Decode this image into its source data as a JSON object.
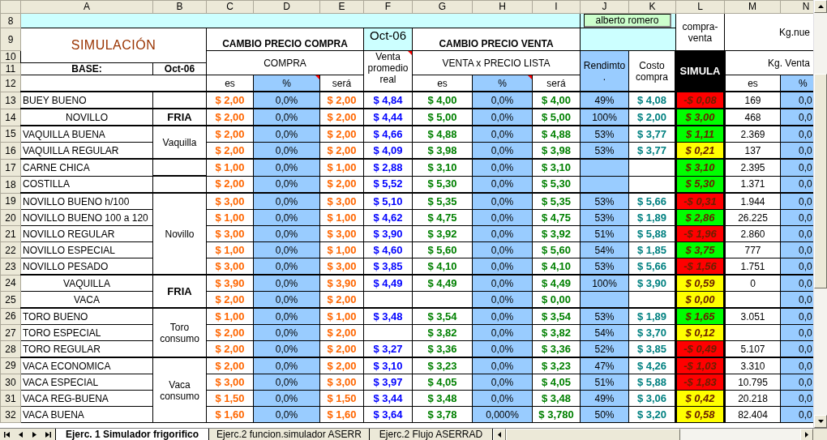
{
  "columns": [
    "A",
    "B",
    "C",
    "D",
    "E",
    "F",
    "G",
    "H",
    "I",
    "J",
    "K",
    "L",
    "M",
    "N"
  ],
  "header_rows": [
    "8",
    "9",
    "10",
    "11",
    "12"
  ],
  "headers": {
    "title": "SIMULACIÓN",
    "base_label": "BASE:",
    "base_value": "Oct-06",
    "compra_group": "CAMBIO PRECIO COMPRA",
    "compra": "COMPRA",
    "compra_cols": [
      "es",
      "%",
      "será"
    ],
    "period": "Oct-06",
    "venta_real": "Venta promedio real",
    "venta_group": "CAMBIO PRECIO VENTA",
    "venta": "VENTA x PRECIO LISTA",
    "venta_cols": [
      "es",
      "%",
      "será"
    ],
    "user": "alberto romero",
    "rendimiento": "Rendimto .",
    "costo": "Costo compra",
    "compra_venta": "compra-venta",
    "simula": "SIMULA",
    "kg_group": "Kg.nue",
    "kg_venta": "Kg. Venta",
    "kg_cols": [
      "es",
      "%"
    ]
  },
  "sections": [
    {
      "centered": false,
      "rows": [
        {
          "row": "13",
          "name": "BUEY BUENO",
          "compra_es": "$ 2,00",
          "compra_pct": "0,0%",
          "compra_sera": "$ 2,00",
          "venta_real": "$ 4,84",
          "venta_es": "$ 4,00",
          "venta_pct": "0,0%",
          "venta_sera": "$ 4,00",
          "rendimiento": "49%",
          "costo": "$ 4,08",
          "simula": {
            "value": "-$ 0,08",
            "color": "#ff0000"
          },
          "kg_es": "169",
          "kg_pct": "0,0"
        }
      ]
    },
    {
      "category": "FRIA",
      "category_bold": true,
      "centered": true,
      "rows": [
        {
          "row": "14",
          "name": "NOVILLO",
          "compra_es": "$ 2,00",
          "compra_pct": "0,0%",
          "compra_sera": "$ 2,00",
          "venta_real": "$ 4,44",
          "venta_es": "$ 5,00",
          "venta_pct": "0,0%",
          "venta_sera": "$ 5,00",
          "rendimiento": "100%",
          "costo": "$ 2,00",
          "simula": {
            "value": "$ 3,00",
            "color": "#00ff00"
          },
          "kg_es": "468",
          "kg_pct": "0,0"
        }
      ]
    },
    {
      "category": "Vaquilla",
      "category_bold": false,
      "centered": false,
      "rows": [
        {
          "row": "15",
          "name": "VAQUILLA BUENA",
          "compra_es": "$ 2,00",
          "compra_pct": "0,0%",
          "compra_sera": "$ 2,00",
          "venta_real": "$ 4,66",
          "venta_es": "$ 4,88",
          "venta_pct": "0,0%",
          "venta_sera": "$ 4,88",
          "rendimiento": "53%",
          "costo": "$ 3,77",
          "simula": {
            "value": "$ 1,11",
            "color": "#00ff00"
          },
          "kg_es": "2.369",
          "kg_pct": "0,0"
        },
        {
          "row": "16",
          "name": "VAQUILLA REGULAR",
          "compra_es": "$ 2,00",
          "compra_pct": "0,0%",
          "compra_sera": "$ 2,00",
          "venta_real": "$ 4,09",
          "venta_es": "$ 3,98",
          "venta_pct": "0,0%",
          "venta_sera": "$ 3,98",
          "rendimiento": "53%",
          "costo": "$ 3,77",
          "simula": {
            "value": "$ 0,21",
            "color": "#ffff00"
          },
          "kg_es": "137",
          "kg_pct": "0,0"
        }
      ]
    },
    {
      "centered": false,
      "rows": [
        {
          "row": "17",
          "name": "CARNE CHICA",
          "compra_es": "$ 1,00",
          "compra_pct": "0,0%",
          "compra_sera": "$ 1,00",
          "venta_real": "$ 2,88",
          "venta_es": "$ 3,10",
          "venta_pct": "0,0%",
          "venta_sera": "$ 3,10",
          "simula": {
            "value": "$ 3,10",
            "color": "#00ff00"
          },
          "kg_es": "2.395",
          "kg_pct": "0,0"
        },
        {
          "row": "18",
          "name": "COSTILLA",
          "compra_es": "$ 2,00",
          "compra_pct": "0,0%",
          "compra_sera": "$ 2,00",
          "venta_real": "$ 5,52",
          "venta_es": "$ 5,30",
          "venta_pct": "0,0%",
          "venta_sera": "$ 5,30",
          "simula": {
            "value": "$ 5,30",
            "color": "#00ff00"
          },
          "kg_es": "1.371",
          "kg_pct": "0,0"
        }
      ]
    },
    {
      "category": "Novillo",
      "category_bold": false,
      "centered": false,
      "rows": [
        {
          "row": "19",
          "name": "NOVILLO BUENO h/100",
          "compra_es": "$ 3,00",
          "compra_pct": "0,0%",
          "compra_sera": "$ 3,00",
          "venta_real": "$ 5,10",
          "venta_es": "$ 5,35",
          "venta_pct": "0,0%",
          "venta_sera": "$ 5,35",
          "rendimiento": "53%",
          "costo": "$ 5,66",
          "simula": {
            "value": "-$ 0,31",
            "color": "#ff0000"
          },
          "kg_es": "1.944",
          "kg_pct": "0,0"
        },
        {
          "row": "20",
          "name": "NOVILLO BUENO 100 a 120",
          "compra_es": "$ 1,00",
          "compra_pct": "0,0%",
          "compra_sera": "$ 1,00",
          "venta_real": "$ 4,62",
          "venta_es": "$ 4,75",
          "venta_pct": "0,0%",
          "venta_sera": "$ 4,75",
          "rendimiento": "53%",
          "costo": "$ 1,89",
          "simula": {
            "value": "$ 2,86",
            "color": "#00ff00"
          },
          "kg_es": "26.225",
          "kg_pct": "0,0"
        },
        {
          "row": "21",
          "name": "NOVILLO REGULAR",
          "compra_es": "$ 3,00",
          "compra_pct": "0,0%",
          "compra_sera": "$ 3,00",
          "venta_real": "$ 3,90",
          "venta_es": "$ 3,92",
          "venta_pct": "0,0%",
          "venta_sera": "$ 3,92",
          "rendimiento": "51%",
          "costo": "$ 5,88",
          "simula": {
            "value": "-$ 1,96",
            "color": "#ff0000"
          },
          "kg_es": "2.860",
          "kg_pct": "0,0"
        },
        {
          "row": "22",
          "name": "NOVILLO ESPECIAL",
          "compra_es": "$ 1,00",
          "compra_pct": "0,0%",
          "compra_sera": "$ 1,00",
          "venta_real": "$ 4,60",
          "venta_es": "$ 5,60",
          "venta_pct": "0,0%",
          "venta_sera": "$ 5,60",
          "rendimiento": "54%",
          "costo": "$ 1,85",
          "simula": {
            "value": "$ 3,75",
            "color": "#00ff00"
          },
          "kg_es": "777",
          "kg_pct": "0,0"
        },
        {
          "row": "23",
          "name": "NOVILLO PESADO",
          "compra_es": "$ 3,00",
          "compra_pct": "0,0%",
          "compra_sera": "$ 3,00",
          "venta_real": "$ 3,85",
          "venta_es": "$ 4,10",
          "venta_pct": "0,0%",
          "venta_sera": "$ 4,10",
          "rendimiento": "53%",
          "costo": "$ 5,66",
          "simula": {
            "value": "-$ 1,56",
            "color": "#ff0000"
          },
          "kg_es": "1.751",
          "kg_pct": "0,0"
        }
      ]
    },
    {
      "category": "FRIA",
      "category_bold": true,
      "centered": true,
      "rows": [
        {
          "row": "24",
          "name": "VAQUILLA",
          "compra_es": "$ 3,90",
          "compra_pct": "0,0%",
          "compra_sera": "$ 3,90",
          "venta_real": "$ 4,49",
          "venta_es": "$ 4,49",
          "venta_pct": "0,0%",
          "venta_sera": "$ 4,49",
          "rendimiento": "100%",
          "costo": "$ 3,90",
          "simula": {
            "value": "$ 0,59",
            "color": "#ffff00"
          },
          "kg_es": "0",
          "kg_pct": "0,0"
        },
        {
          "row": "25",
          "name": "VACA",
          "compra_es": "$ 2,00",
          "compra_pct": "0,0%",
          "compra_sera": "$ 2,00",
          "venta_pct": "0,0%",
          "venta_sera": "$ 0,00",
          "simula": {
            "value": "$ 0,00",
            "color": "#ffff00"
          },
          "kg_pct": "0,0"
        }
      ]
    },
    {
      "category": "Toro consumo",
      "category_bold": false,
      "centered": false,
      "rows": [
        {
          "row": "26",
          "name": "TORO BUENO",
          "compra_es": "$ 1,00",
          "compra_pct": "0,0%",
          "compra_sera": "$ 1,00",
          "venta_real": "$ 3,48",
          "venta_es": "$ 3,54",
          "venta_pct": "0,0%",
          "venta_sera": "$ 3,54",
          "rendimiento": "53%",
          "costo": "$ 1,89",
          "simula": {
            "value": "$ 1,65",
            "color": "#00ff00"
          },
          "kg_es": "3.051",
          "kg_pct": "0,0"
        },
        {
          "row": "27",
          "name": "TORO ESPECIAL",
          "compra_es": "$ 2,00",
          "compra_pct": "0,0%",
          "compra_sera": "$ 2,00",
          "venta_es": "$ 3,82",
          "venta_pct": "0,0%",
          "venta_sera": "$ 3,82",
          "rendimiento": "54%",
          "costo": "$ 3,70",
          "simula": {
            "value": "$ 0,12",
            "color": "#ffff00"
          },
          "kg_pct": "0,0"
        },
        {
          "row": "28",
          "name": "TORO REGULAR",
          "compra_es": "$ 2,00",
          "compra_pct": "0,0%",
          "compra_sera": "$ 2,00",
          "venta_real": "$ 3,27",
          "venta_es": "$ 3,36",
          "venta_pct": "0,0%",
          "venta_sera": "$ 3,36",
          "rendimiento": "52%",
          "costo": "$ 3,85",
          "simula": {
            "value": "-$ 0,49",
            "color": "#ff0000"
          },
          "kg_es": "5.107",
          "kg_pct": "0,0"
        }
      ]
    },
    {
      "category": "Vaca consumo",
      "category_bold": false,
      "centered": false,
      "rows": [
        {
          "row": "29",
          "name": "VACA ECONOMICA",
          "compra_es": "$ 2,00",
          "compra_pct": "0,0%",
          "compra_sera": "$ 2,00",
          "venta_real": "$ 3,10",
          "venta_es": "$ 3,23",
          "venta_pct": "0,0%",
          "venta_sera": "$ 3,23",
          "rendimiento": "47%",
          "costo": "$ 4,26",
          "simula": {
            "value": "-$ 1,03",
            "color": "#ff0000"
          },
          "kg_es": "3.310",
          "kg_pct": "0,0"
        },
        {
          "row": "30",
          "name": "VACA ESPECIAL",
          "compra_es": "$ 3,00",
          "compra_pct": "0,0%",
          "compra_sera": "$ 3,00",
          "venta_real": "$ 3,97",
          "venta_es": "$ 4,05",
          "venta_pct": "0,0%",
          "venta_sera": "$ 4,05",
          "rendimiento": "51%",
          "costo": "$ 5,88",
          "simula": {
            "value": "-$ 1,83",
            "color": "#ff0000"
          },
          "kg_es": "10.795",
          "kg_pct": "0,0"
        },
        {
          "row": "31",
          "name": "VACA REG-BUENA",
          "compra_es": "$ 1,50",
          "compra_pct": "0,0%",
          "compra_sera": "$ 1,50",
          "venta_real": "$ 3,44",
          "venta_es": "$ 3,48",
          "venta_pct": "0,0%",
          "venta_sera": "$ 3,48",
          "rendimiento": "49%",
          "costo": "$ 3,06",
          "simula": {
            "value": "$ 0,42",
            "color": "#ffff00"
          },
          "kg_es": "20.218",
          "kg_pct": "0,0"
        },
        {
          "row": "32",
          "name": "VACA BUENA",
          "compra_es": "$ 1,60",
          "compra_pct": "0,0%",
          "compra_sera": "$ 1,60",
          "venta_real": "$ 3,64",
          "venta_es": "$ 3,78",
          "venta_pct": "0,000%",
          "venta_sera": "$ 3,780",
          "rendimiento": "50%",
          "costo": "$ 3,20",
          "simula": {
            "value": "$ 0,58",
            "color": "#ffff00"
          },
          "kg_es": "82.404",
          "kg_pct": "0,0"
        }
      ]
    }
  ],
  "sheet_tabs": [
    {
      "label": "Ejerc. 1 Simulador frigorifico",
      "selected": true
    },
    {
      "label": "Ejerc.2 funcion.simulador ASERR",
      "selected": false
    },
    {
      "label": "Ejerc.2 Flujo ASERRAD",
      "selected": false
    }
  ]
}
